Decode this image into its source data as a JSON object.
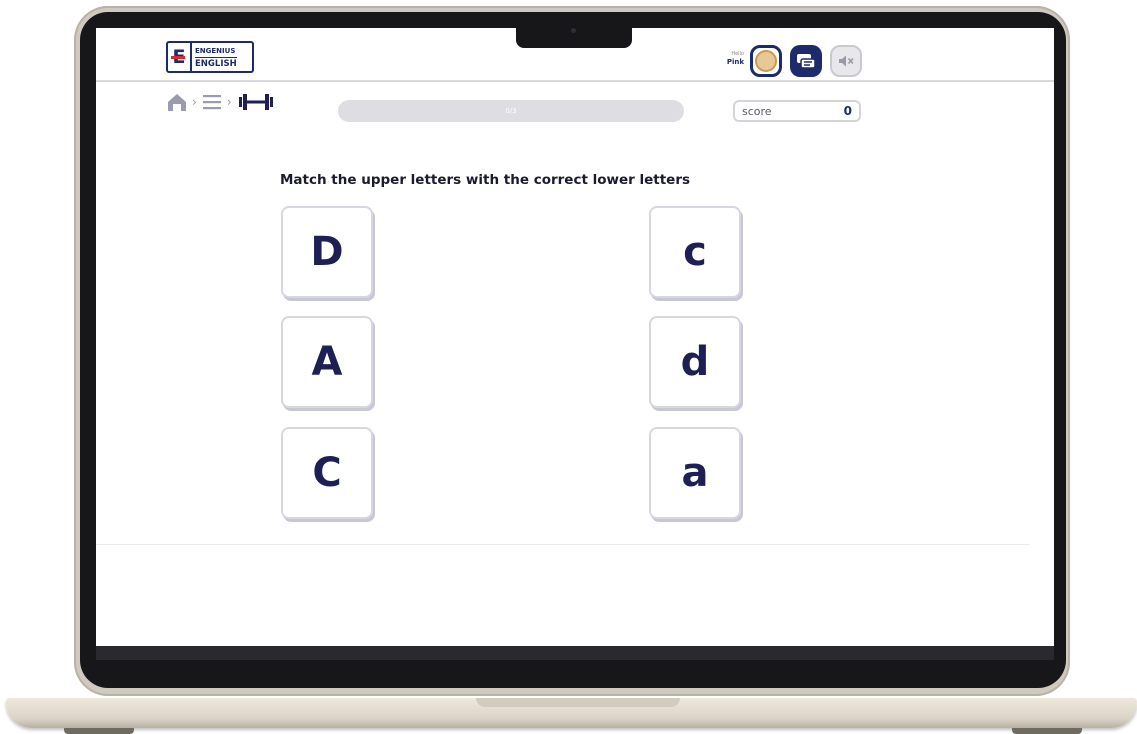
{
  "brand": {
    "line1": "ENGENIUS",
    "line2": "ENGLISH",
    "letter": "E"
  },
  "user": {
    "greeting": "Hello",
    "name": "Pink"
  },
  "header_icons": [
    "avatar-icon",
    "language-icon",
    "mute-icon"
  ],
  "breadcrumb": {
    "items": [
      "home-icon",
      "menu-icon",
      "exercise-dumbbell-icon"
    ]
  },
  "progress": {
    "label": "0/3",
    "value": 0
  },
  "score": {
    "label": "score",
    "value": "0"
  },
  "instruction": "Match the upper letters with the correct lower letters",
  "upper_cards": [
    "D",
    "A",
    "C"
  ],
  "lower_cards": [
    "c",
    "d",
    "a"
  ],
  "colors": {
    "brand_navy": "#1d2a6b",
    "brand_red": "#e2232a",
    "progress_track": "#dedee2"
  }
}
